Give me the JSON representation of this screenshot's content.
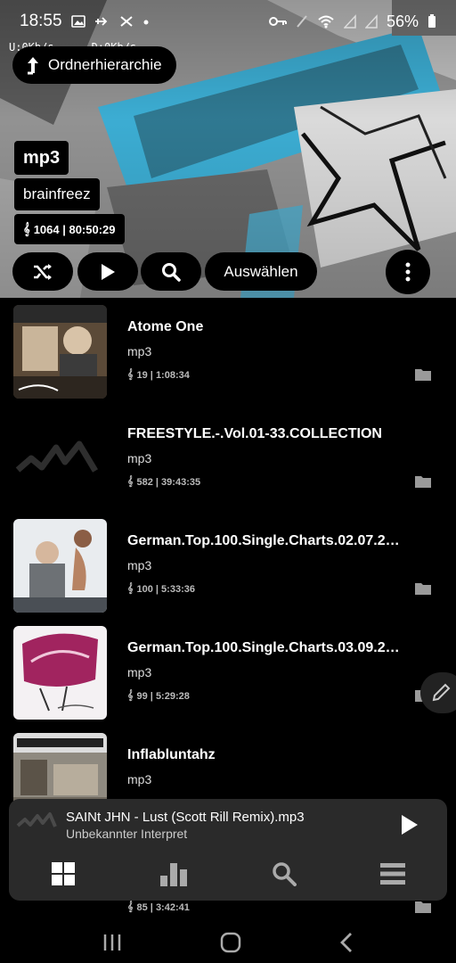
{
  "status_bar": {
    "time": "18:55",
    "battery": "56%",
    "upload_speed": "U:0Kb/s",
    "download_speed": "D:0Kb/s"
  },
  "header": {
    "breadcrumb_label": "Ordnerhierarchie",
    "folder_type": "mp3",
    "artist": "brainfreez",
    "stats": "1064 | 80:50:29",
    "select_label": "Auswählen"
  },
  "list": {
    "items": [
      {
        "title": "Atome One",
        "subtitle": "mp3",
        "stats": "19 | 1:08:34"
      },
      {
        "title": "FREESTYLE.-.Vol.01-33.COLLECTION",
        "subtitle": "mp3",
        "stats": "582 | 39:43:35"
      },
      {
        "title": "German.Top.100.Single.Charts.02.07.2…",
        "subtitle": "mp3",
        "stats": "100 | 5:33:36"
      },
      {
        "title": "German.Top.100.Single.Charts.03.09.2…",
        "subtitle": "mp3",
        "stats": "99 | 5:29:28"
      },
      {
        "title": "Inflabluntahz",
        "subtitle": "mp3",
        "stats": ""
      },
      {
        "title": "",
        "subtitle": "",
        "stats": "85 | 3:42:41"
      }
    ]
  },
  "player": {
    "song": "SAINt JHN - Lust (Scott Rill Remix).mp3",
    "artist": "Unbekannter Interpret"
  },
  "colors": {
    "background": "#000000",
    "player_bg": "#2a2a2a",
    "text": "#ffffff"
  }
}
